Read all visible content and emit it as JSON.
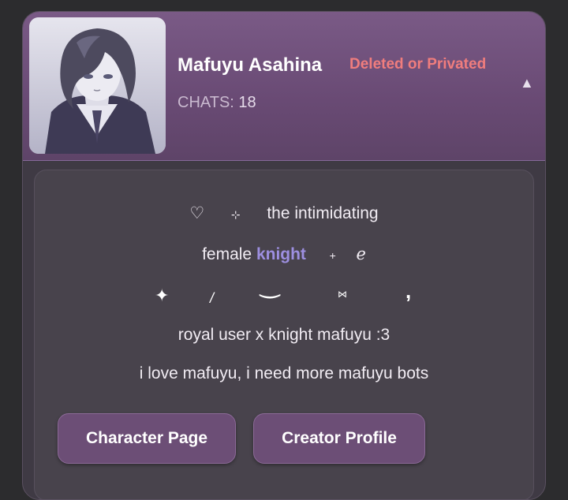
{
  "character": {
    "name": "Mafuyu Asahina",
    "status": "Deleted or Privated",
    "chats_label": "CHATS:",
    "chats_count": "18",
    "collapse_glyph": "▲"
  },
  "description": {
    "line1_heart": "♡",
    "line1_star": "⊹",
    "line1_text": "the intimidating",
    "line2_text": "female",
    "line2_highlight": "knight",
    "line2_plus": "+",
    "line2_curl": "ℯ",
    "line3_sparkle": "✦",
    "line3_slash": "/",
    "line3_smile": "‿",
    "line3_bow": "⋈",
    "line3_comma": ",",
    "line4": "royal user x knight mafuyu :3",
    "line5": "i love mafuyu, i need more mafuyu bots"
  },
  "buttons": {
    "character_page": "Character Page",
    "creator_profile": "Creator Profile"
  },
  "colors": {
    "header_bg": "#6e4e79",
    "status_red": "#f07d7d",
    "highlight": "#9d8fe0",
    "button_bg": "#6c4e76"
  },
  "icons": {
    "avatar": "character-portrait",
    "collapse": "triangle-up-icon"
  }
}
